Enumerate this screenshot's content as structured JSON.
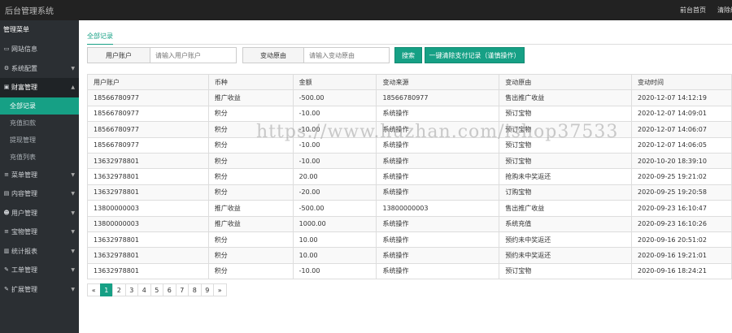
{
  "app": {
    "title": "后台管理系统",
    "top_links": [
      "前台首页",
      "清除缓存"
    ]
  },
  "sidebar": {
    "header": "管理菜单",
    "items": [
      {
        "label": "网站信息",
        "icon": "monitor-icon",
        "glyph": "▭"
      },
      {
        "label": "系统配置",
        "icon": "gears-icon",
        "glyph": "⚙",
        "arrow": "▼"
      },
      {
        "label": "财富管理",
        "icon": "money-icon",
        "glyph": "▣",
        "arrow": "▲",
        "expanded": true,
        "children": [
          "全部记录",
          "充值扣款",
          "提现管理",
          "充值列表"
        ]
      },
      {
        "label": "菜单管理",
        "icon": "list-icon",
        "glyph": "≡",
        "arrow": "▼"
      },
      {
        "label": "内容管理",
        "icon": "file-icon",
        "glyph": "▤",
        "arrow": "▼"
      },
      {
        "label": "用户管理",
        "icon": "users-icon",
        "glyph": "☻",
        "arrow": "▼"
      },
      {
        "label": "宝物管理",
        "icon": "list-icon",
        "glyph": "≡",
        "arrow": "▼"
      },
      {
        "label": "统计报表",
        "icon": "chart-icon",
        "glyph": "▥",
        "arrow": "▼"
      },
      {
        "label": "工单管理",
        "icon": "wrench-icon",
        "glyph": "✎",
        "arrow": "▼"
      },
      {
        "label": "扩展管理",
        "icon": "wrench-icon",
        "glyph": "✎",
        "arrow": "▼"
      }
    ],
    "active_child": "全部记录"
  },
  "main": {
    "tab": "全部记录",
    "search": {
      "user_label": "用户账户",
      "user_placeholder": "请输入用户账户",
      "reason_label": "变动原由",
      "reason_placeholder": "请输入变动原由",
      "search_button": "搜索",
      "clear_button": "一键清除支付记录（谨慎操作）"
    },
    "table": {
      "columns": [
        "用户账户",
        "币种",
        "金额",
        "变动来源",
        "变动原由",
        "变动时间"
      ],
      "rows": [
        [
          "18566780977",
          "推广收益",
          "-500.00",
          "18566780977",
          "售出推广收益",
          "2020-12-07 14:12:19"
        ],
        [
          "18566780977",
          "积分",
          "-10.00",
          "系统操作",
          "预订宝物",
          "2020-12-07 14:09:01"
        ],
        [
          "18566780977",
          "积分",
          "-10.00",
          "系统操作",
          "预订宝物",
          "2020-12-07 14:06:07"
        ],
        [
          "18566780977",
          "积分",
          "-10.00",
          "系统操作",
          "预订宝物",
          "2020-12-07 14:06:05"
        ],
        [
          "13632978801",
          "积分",
          "-10.00",
          "系统操作",
          "预订宝物",
          "2020-10-20 18:39:10"
        ],
        [
          "13632978801",
          "积分",
          "20.00",
          "系统操作",
          "抢购未中奖返还",
          "2020-09-25 19:21:02"
        ],
        [
          "13632978801",
          "积分",
          "-20.00",
          "系统操作",
          "订购宝物",
          "2020-09-25 19:20:58"
        ],
        [
          "13800000003",
          "推广收益",
          "-500.00",
          "13800000003",
          "售出推广收益",
          "2020-09-23 16:10:47"
        ],
        [
          "13800000003",
          "推广收益",
          "1000.00",
          "系统操作",
          "系统充值",
          "2020-09-23 16:10:26"
        ],
        [
          "13632978801",
          "积分",
          "10.00",
          "系统操作",
          "预约未中奖返还",
          "2020-09-16 20:51:02"
        ],
        [
          "13632978801",
          "积分",
          "10.00",
          "系统操作",
          "预约未中奖返还",
          "2020-09-16 19:21:01"
        ],
        [
          "13632978801",
          "积分",
          "-10.00",
          "系统操作",
          "预订宝物",
          "2020-09-16 18:24:21"
        ]
      ]
    },
    "pagination": {
      "prev": "«",
      "pages": [
        "1",
        "2",
        "3",
        "4",
        "5",
        "6",
        "7",
        "8",
        "9"
      ],
      "next": "»",
      "current": "1"
    },
    "watermark": "https://www.huzhan.com/ishop37533"
  }
}
